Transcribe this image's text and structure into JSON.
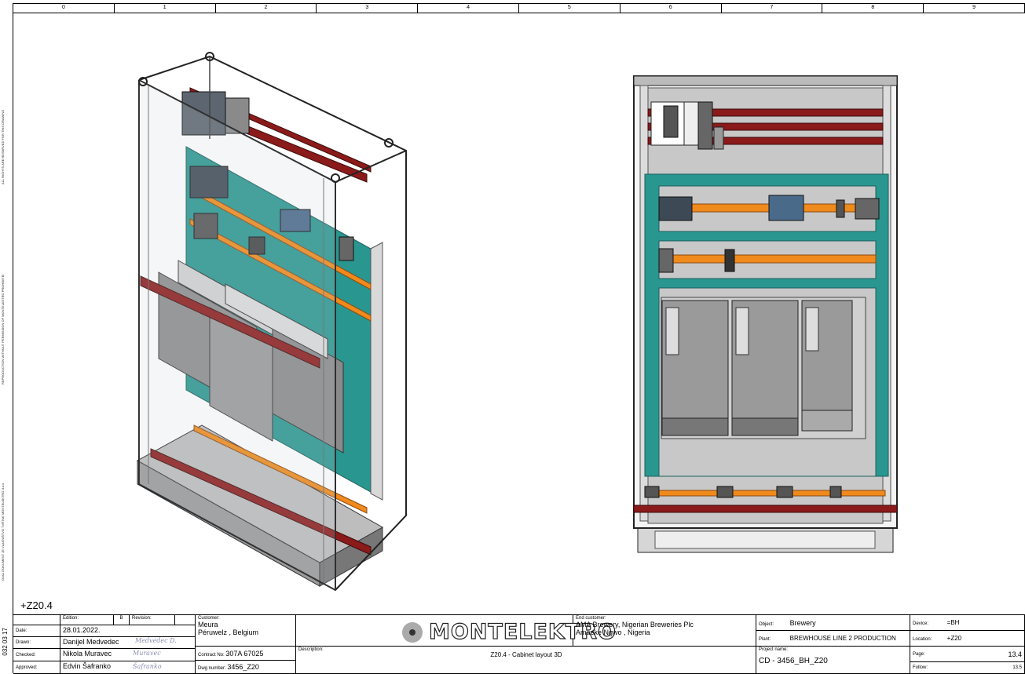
{
  "columns": [
    "0",
    "1",
    "2",
    "3",
    "4",
    "5",
    "6",
    "7",
    "8",
    "9"
  ],
  "side_notes": [
    "ALL RIGHTS ARE RESERVED FOR THIS DRAWING",
    "REPRODUCTION WITHOUT PERMISSION OF MONTELEKTRO PROHIBITED",
    "OVAJ DOKUMENT JE VLASNIŠTVO TVRTKE MONTELEKTRO d.o.o."
  ],
  "doc_number": "032 03 17",
  "cabinet_ref": "+Z20.4",
  "title_block": {
    "edition_label": "Edition:",
    "edition_value": "B",
    "revision_label": "Revision:",
    "date_label": "Date:",
    "date_value": "28.01.2022.",
    "drawn_label": "Drawn:",
    "drawn_value": "Danijel Medvedec",
    "checked_label": "Checked:",
    "checked_value": "Nikola Muravec",
    "approved_label": "Approved:",
    "approved_value": "Edvin Šafranko",
    "customer_label": "Customer:",
    "customer_name": "Meura",
    "customer_location": "Péruwelz , Belgium",
    "contract_label": "Contract No:",
    "contract_value": "307A 67025",
    "dwg_label": "Dwg number:",
    "dwg_value": "3456_Z20",
    "description_label": "Description:",
    "description_value": "Z20.4 - Cabinet layout 3D",
    "logo_text": "MONTELEKTRO",
    "end_customer_label": "End customer:",
    "end_customer_name": "AMA Brewery, Nigerian Breweries Plc",
    "end_customer_location": "Amaeke Ngwo , Nigeria",
    "object_label": "Object:",
    "object_value": "Brewery",
    "plant_label": "Plant:",
    "plant_value": "BREWHOUSE LINE 2 PRODUCTION",
    "project_label": "Project name:",
    "project_value": "CD - 3456_BH_Z20",
    "device_label": "Device:",
    "device_value": "=BH",
    "location_label": "Location:",
    "location_value": "+Z20",
    "page_label": "Page:",
    "page_value": "13.4",
    "follow_label": "Follow:",
    "follow_value": "13.5"
  },
  "colors": {
    "teal": "#2a9690",
    "busbar_red": "#8b1a1a",
    "rail_orange": "#f08a1c",
    "plate_grey": "#c8c8c8"
  }
}
